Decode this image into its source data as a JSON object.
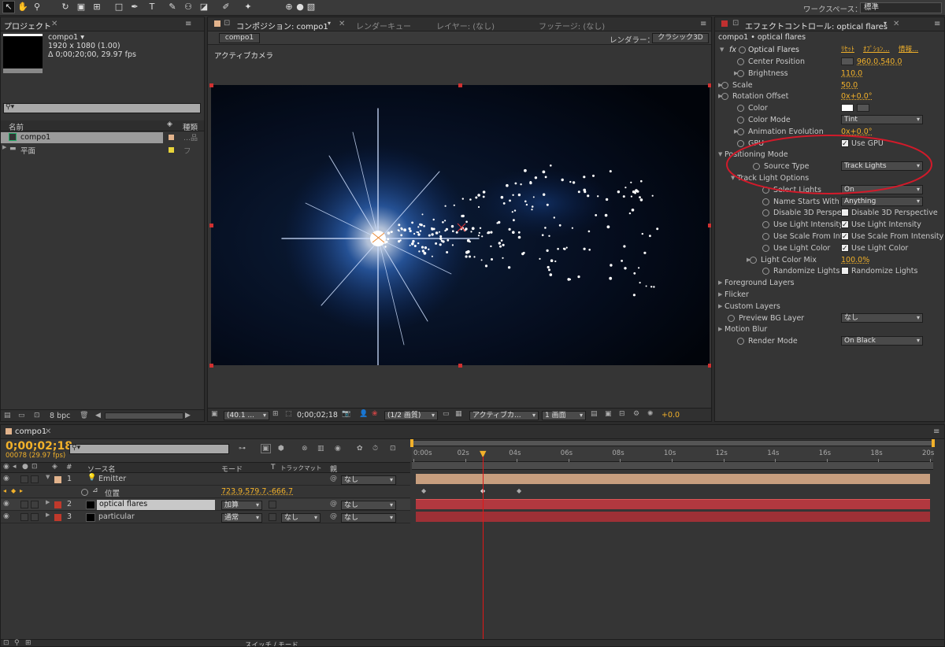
{
  "workspace": {
    "label": "ワークスペース：",
    "value": "標準"
  },
  "project": {
    "tab": "プロジェクト",
    "comp_name": "compo1 ▾",
    "info1": "1920 x 1080 (1.00)",
    "info2": "Δ 0;00;20;00, 29.97 fps",
    "col_name": "名前",
    "col_type": "種類",
    "items": [
      "compo1",
      "平面"
    ],
    "item2_type": "フ",
    "bpc": "8 bpc"
  },
  "comp": {
    "tab": "コンポジション: compo1",
    "tabs": [
      "レンダーキュー",
      "レイヤー: (なし)",
      "フッテージ: (なし)"
    ],
    "subtab": "compo1",
    "renderer_label": "レンダラー：",
    "renderer": "クラシック3D",
    "camera": "アクティブカメラ",
    "zoom": "(40.1 ...",
    "timecode": "0;00;02;18",
    "res": "(1/2 画質)",
    "view": "アクティブカ...",
    "views": "1 画面",
    "exposure": "+0.0"
  },
  "effects": {
    "tab": "エフェクトコントロール: optical flares",
    "layer": "compo1 • optical flares",
    "effect": "Optical Flares",
    "reset": "ﾘｾｯﾄ",
    "options": "ｵﾌﾟｼｮﾝ...",
    "info": "情報...",
    "props": [
      {
        "label": "Center Position",
        "value": "960.0,540.0"
      },
      {
        "label": "Brightness",
        "value": "110.0"
      },
      {
        "label": "Scale",
        "value": "50.0"
      },
      {
        "label": "Rotation Offset",
        "value": "0x+0.0°"
      },
      {
        "label": "Color",
        "value": ""
      },
      {
        "label": "Color Mode",
        "value": "Tint"
      },
      {
        "label": "Animation Evolution",
        "value": "0x+0.0°"
      },
      {
        "label": "GPU",
        "value": "Use GPU"
      },
      {
        "label": "Positioning Mode",
        "value": ""
      },
      {
        "label": "Source Type",
        "value": "Track Lights"
      },
      {
        "label": "Track Light Options",
        "value": ""
      },
      {
        "label": "Select Lights",
        "value": "On"
      },
      {
        "label": "Name Starts With",
        "value": "Anything"
      },
      {
        "label": "Disable 3D Perspec",
        "value": "Disable 3D Perspective"
      },
      {
        "label": "Use Light Intensity",
        "value": "Use Light Intensity"
      },
      {
        "label": "Use Scale From Inte",
        "value": "Use Scale From Intensity"
      },
      {
        "label": "Use Light Color",
        "value": "Use Light Color"
      },
      {
        "label": "Light Color Mix",
        "value": "100.0%"
      },
      {
        "label": "Randomize Lights",
        "value": "Randomize Lights"
      },
      {
        "label": "Foreground Layers",
        "value": ""
      },
      {
        "label": "Flicker",
        "value": ""
      },
      {
        "label": "Custom Layers",
        "value": ""
      },
      {
        "label": "Preview BG Layer",
        "value": "なし"
      },
      {
        "label": "Motion Blur",
        "value": ""
      },
      {
        "label": "Render Mode",
        "value": "On Black"
      }
    ]
  },
  "timeline": {
    "tab": "compo1",
    "timecode": "0;00;02;18",
    "frames": "00078 (29.97 fps)",
    "col_num": "#",
    "col_source": "ソース名",
    "col_mode": "モード",
    "col_t": "T",
    "col_track": "トラックマット",
    "col_parent": "親",
    "footer": "スイッチ / モード",
    "ticks": [
      "0:00s",
      "02s",
      "04s",
      "06s",
      "08s",
      "10s",
      "12s",
      "14s",
      "16s",
      "18s",
      "20s"
    ],
    "layers": [
      {
        "num": "1",
        "name": "Emitter",
        "mode": "",
        "track": "",
        "parent": "なし",
        "color": "#e2b38c"
      },
      {
        "num": "",
        "name": "位置",
        "mode": "723.9,579.7,-666.7",
        "track": "",
        "parent": "",
        "color": ""
      },
      {
        "num": "2",
        "name": "optical flares",
        "mode": "加算",
        "track": "",
        "parent": "なし",
        "color": "#c0392b"
      },
      {
        "num": "3",
        "name": "particular",
        "mode": "通常",
        "track": "なし",
        "parent": "なし",
        "color": "#c0392b"
      }
    ]
  },
  "colors": {
    "accent": "#f2b12a",
    "playhead": "#e01818",
    "annotation": "#d21a2a"
  }
}
